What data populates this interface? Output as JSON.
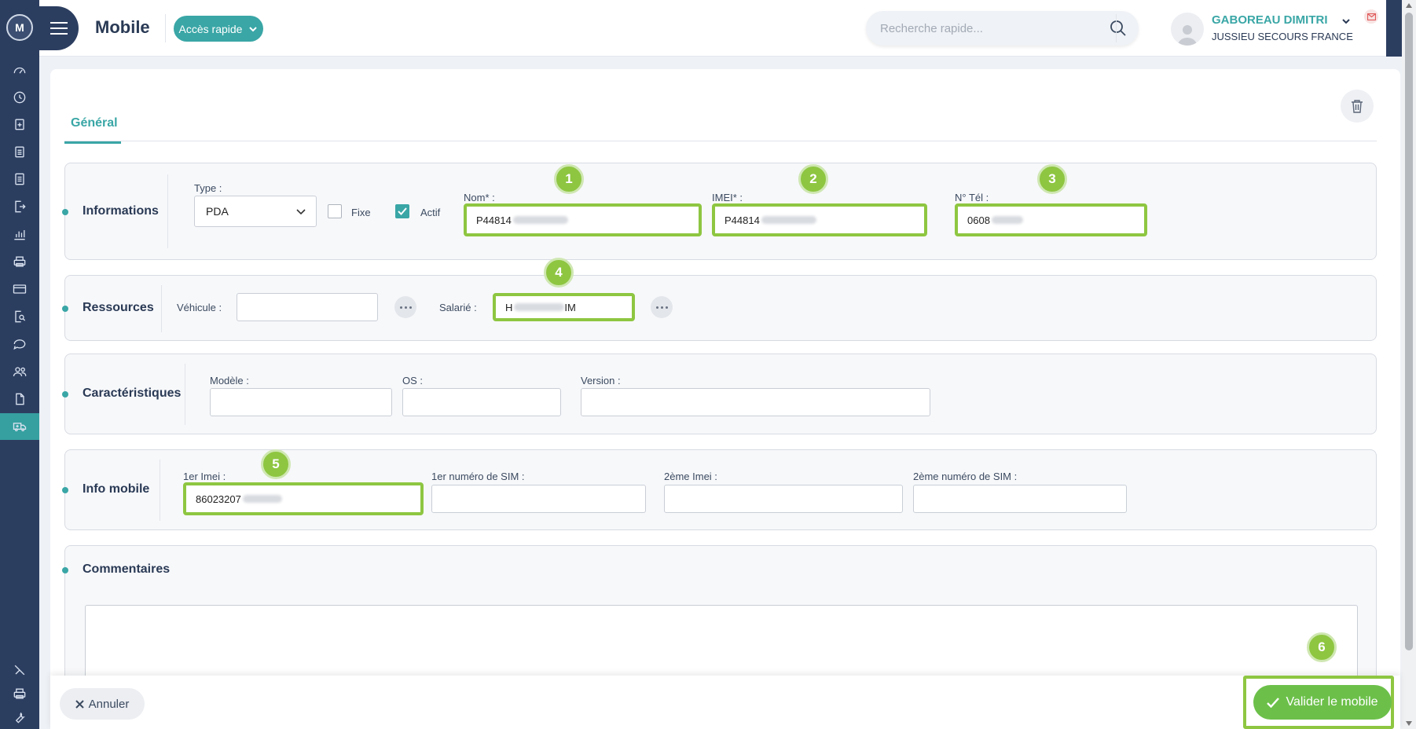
{
  "app": {
    "logo_text": "M",
    "page_title": "Mobile",
    "quick_access_label": "Accès rapide"
  },
  "search": {
    "placeholder": "Recherche rapide..."
  },
  "user": {
    "name": "GABOREAU DIMITRI",
    "organization": "JUSSIEU SECOURS FRANCE"
  },
  "sidebar": {
    "icons": [
      "dashboard-icon",
      "clock-icon",
      "clipboard-plus-icon",
      "clipboard-list-icon",
      "document-list-icon",
      "document-export-icon",
      "chart-icon",
      "printer-icon",
      "credit-card-icon",
      "document-search-icon",
      "chat-icon",
      "users-icon",
      "file-icon",
      "ambulance-icon"
    ],
    "bottom_icons": [
      "tools-icon",
      "printer-icon",
      "wrench-icon"
    ],
    "active": "ambulance-icon"
  },
  "tabs": {
    "general": "Général"
  },
  "sections": {
    "informations": {
      "title": "Informations",
      "type_label": "Type :",
      "type_value": "PDA",
      "fixe_label": "Fixe",
      "fixe_checked": false,
      "actif_label": "Actif",
      "actif_checked": true,
      "nom_label": "Nom* :",
      "nom_value": "P44814",
      "imei_label": "IMEI* :",
      "imei_value": "P44814",
      "tel_label": "N° Tél :",
      "tel_value": "0608"
    },
    "ressources": {
      "title": "Ressources",
      "vehicule_label": "Véhicule :",
      "vehicule_value": "",
      "salarie_label": "Salarié :",
      "salarie_prefix": "H",
      "salarie_suffix": "IM"
    },
    "caracteristiques": {
      "title": "Caractéristiques",
      "modele_label": "Modèle :",
      "os_label": "OS :",
      "version_label": "Version :"
    },
    "info_mobile": {
      "title": "Info mobile",
      "imei1_label": "1er Imei :",
      "imei1_value": "86023207",
      "sim1_label": "1er numéro de SIM :",
      "imei2_label": "2ème Imei :",
      "sim2_label": "2ème numéro de SIM :"
    },
    "commentaires": {
      "title": "Commentaires"
    }
  },
  "badges": [
    "1",
    "2",
    "3",
    "4",
    "5",
    "6"
  ],
  "footer": {
    "cancel_label": "Annuler",
    "validate_label": "Valider le mobile"
  },
  "colors": {
    "accent": "#3aa6a6",
    "navy": "#2c3e60",
    "highlight": "#8ec641",
    "validate": "#6cc04a"
  }
}
